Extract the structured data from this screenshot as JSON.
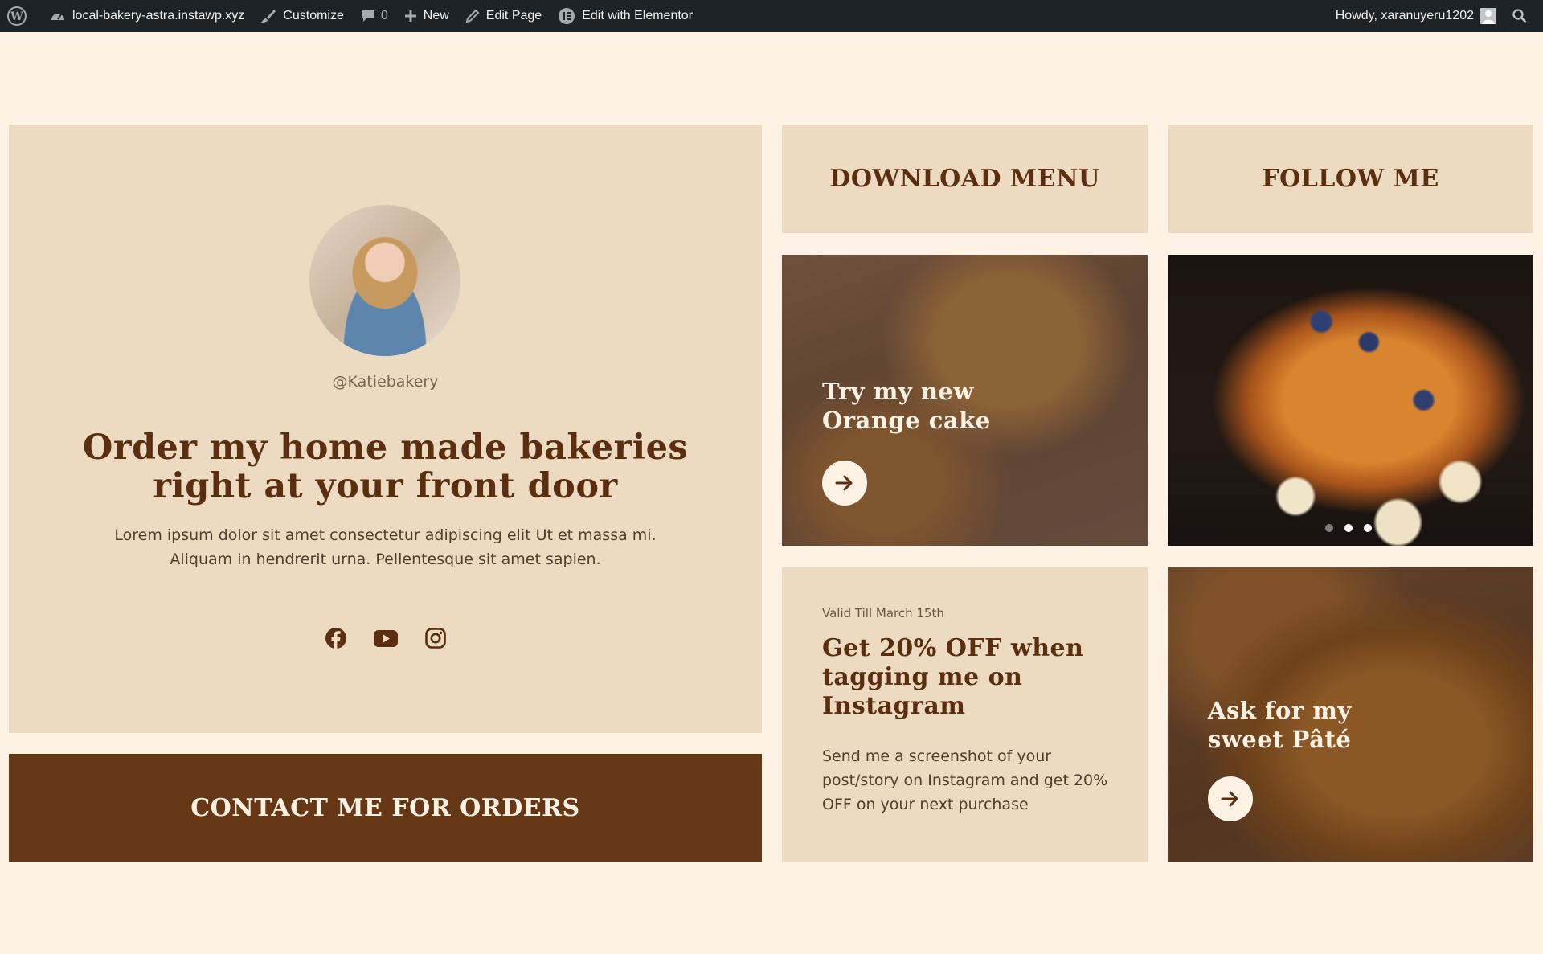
{
  "admin_bar": {
    "site_name": "local-bakery-astra.instawp.xyz",
    "customize": "Customize",
    "comments_count": "0",
    "new": "New",
    "edit_page": "Edit Page",
    "edit_elementor": "Edit with Elementor",
    "howdy": "Howdy, xaranuyeru1202"
  },
  "profile": {
    "handle": "@Katiebakery",
    "title": "Order my home made bakeries right at your front door",
    "text": "Lorem ipsum dolor sit amet consectetur adipiscing elit Ut et massa mi. Aliquam in hendrerit urna. Pellentesque sit amet sapien.",
    "socials": [
      "facebook-icon",
      "youtube-icon",
      "instagram-icon"
    ]
  },
  "contact_button": "CONTACT ME FOR ORDERS",
  "download_menu": "DOWNLOAD MENU",
  "follow_me": "FOLLOW ME",
  "cake_card": {
    "title_line1": "Try my new",
    "title_line2": "Orange cake"
  },
  "carousel": {
    "slides": 3,
    "active": 3
  },
  "promo": {
    "valid": "Valid Till March 15th",
    "title": "Get 20% OFF when tagging me on Instagram",
    "text": "Send me a screenshot of your post/story on Instagram and get 20% OFF on your next purchase"
  },
  "pate_card": {
    "title_line1": "Ask for my",
    "title_line2": "sweet Pâté"
  },
  "colors": {
    "page_bg": "#fdf2e3",
    "panel": "#eddbc1",
    "brown": "#663714",
    "heading": "#5a2e0e",
    "adminbar": "#1d2327"
  }
}
